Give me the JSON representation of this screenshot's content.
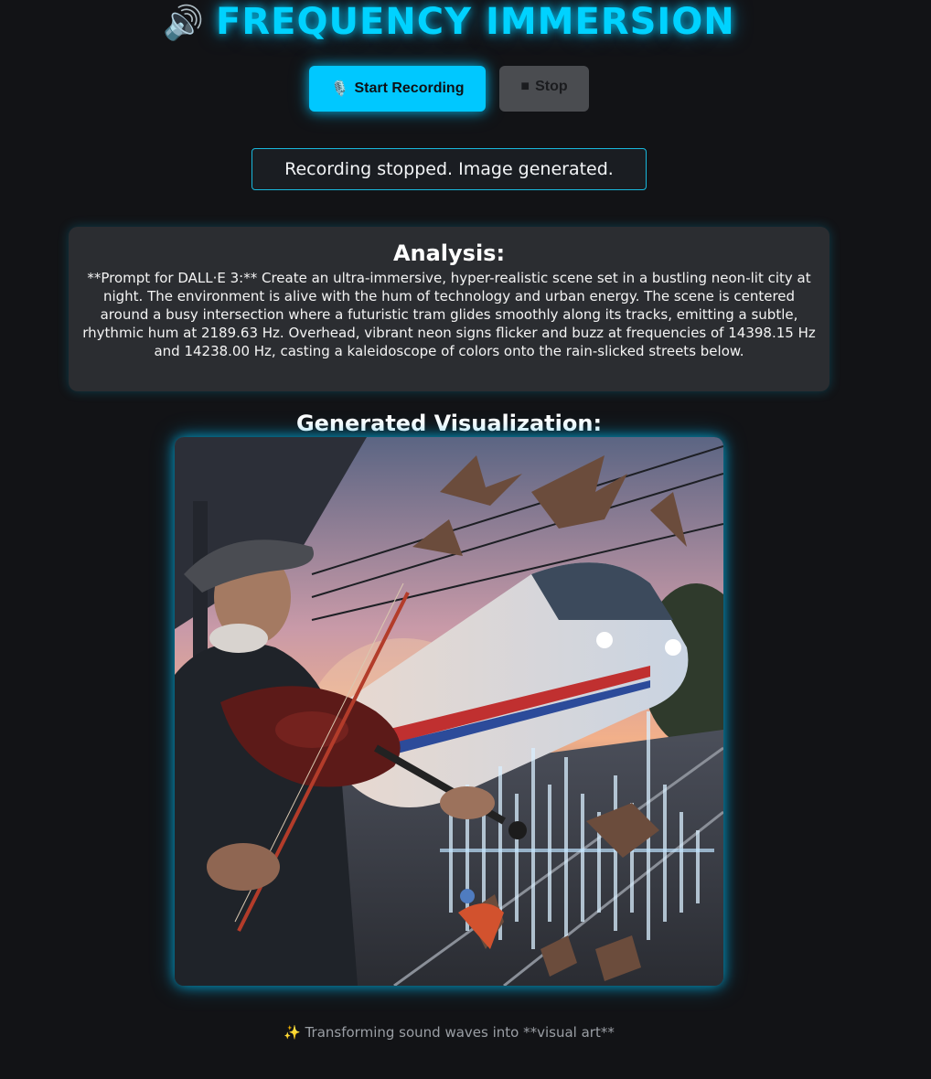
{
  "header": {
    "title": "FREQUENCY IMMERSION",
    "title_icon": "speaker-icon",
    "title_icon_glyph": "🔊",
    "accent_color": "#00d2ff"
  },
  "controls": {
    "start_label": "Start Recording",
    "start_icon": "microphone-icon",
    "start_icon_glyph": "🎙️",
    "stop_label": "Stop",
    "stop_icon": "stop-square-icon",
    "stop_icon_glyph": "■"
  },
  "status": {
    "text": "Recording stopped. Image generated."
  },
  "analysis": {
    "heading": "Analysis:",
    "body": "**Prompt for DALL·E 3:** Create an ultra-immersive, hyper-realistic scene set in a bustling neon-lit city at night. The environment is alive with the hum of technology and urban energy. The scene is centered around a busy intersection where a futuristic tram glides smoothly along its tracks, emitting a subtle, rhythmic hum at 2189.63 Hz. Overhead, vibrant neon signs flicker and buzz at frequencies of 14398.15 Hz and 14238.00 Hz, casting a kaleidoscope of colors onto the rain-slicked streets below."
  },
  "visualization": {
    "heading": "Generated Visualization:"
  },
  "footer": {
    "text": "✨ Transforming sound waves into **visual art**"
  }
}
